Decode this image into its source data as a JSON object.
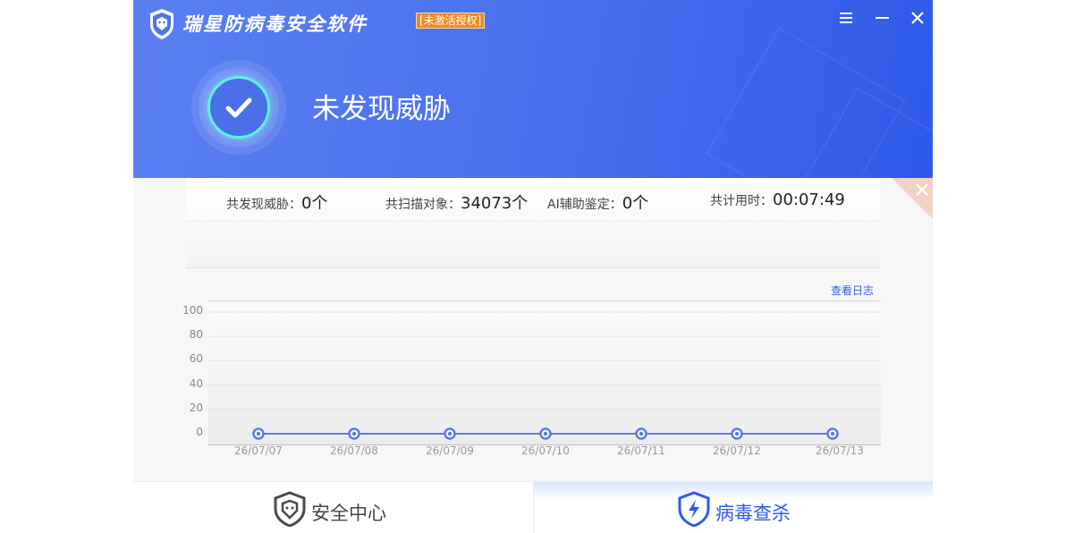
{
  "app": {
    "title": "瑞星防病毒安全软件",
    "license_badge": "[未激活授权]",
    "menu_icon": "menu-icon",
    "minimize_icon": "minimize-icon",
    "close_icon": "close-icon"
  },
  "status": {
    "icon": "check-icon",
    "text": "未发现威胁"
  },
  "stats": [
    {
      "label": "共发现威胁：",
      "value": "0个"
    },
    {
      "label": "共扫描对象：",
      "value": "34073个"
    },
    {
      "label": "AI辅助鉴定：",
      "value": "0个"
    },
    {
      "label": "共计用时：",
      "value": "00:07:49"
    }
  ],
  "view_log": "查看日志",
  "colors": {
    "accent": "#4b72ee",
    "check_ring": "#5ff0e0",
    "line": "#5b7be6",
    "badge": "#f28b22"
  },
  "chart_data": {
    "type": "line",
    "categories": [
      "26/07/07",
      "26/07/08",
      "26/07/09",
      "26/07/10",
      "26/07/11",
      "26/07/12",
      "26/07/13"
    ],
    "series": [
      {
        "values": [
          0,
          0,
          0,
          0,
          0,
          0,
          0
        ]
      }
    ],
    "yticks": [
      "100",
      "80",
      "60",
      "40",
      "20",
      "0"
    ],
    "ylim": [
      0,
      100
    ],
    "grid": true
  },
  "tabs": [
    {
      "label": "安全中心",
      "icon": "lion-shield-icon",
      "active": false
    },
    {
      "label": "病毒查杀",
      "icon": "lightning-shield-icon",
      "active": true
    }
  ]
}
